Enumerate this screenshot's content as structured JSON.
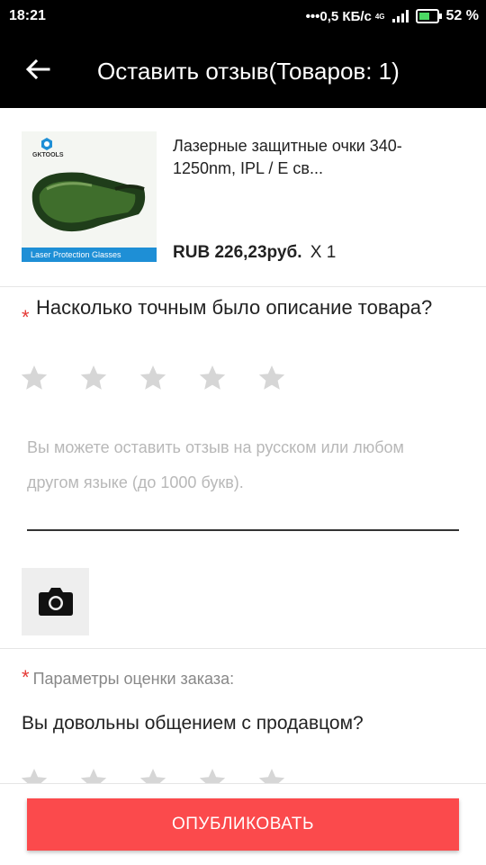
{
  "status_bar": {
    "time": "18:21",
    "network_speed": "0,5 КБ/с",
    "network_type": "4G",
    "battery": "52 %"
  },
  "header": {
    "title": "Оставить отзыв(Товаров: 1)"
  },
  "product": {
    "name": "Лазерные защитные очки 340-1250nm, IPL / E св...",
    "image_brand": "GKTOOLS",
    "image_caption": "Laser Protection Glasses",
    "price": "RUB 226,23руб.",
    "quantity": "X 1"
  },
  "question1": {
    "required_mark": "*",
    "text": "Насколько точным было описание товара?",
    "rating": 0
  },
  "review": {
    "placeholder": "Вы можете оставить отзыв на русском или любом другом языке (до 1000 букв)."
  },
  "params": {
    "required_mark": "*",
    "label": "Параметры оценки заказа:"
  },
  "question2": {
    "text": "Вы довольны общением с продавцом?",
    "rating": 0
  },
  "publish_button": {
    "label": "ОПУБЛИКОВАТЬ"
  },
  "colors": {
    "accent": "#fb4a4c",
    "required": "#e53935",
    "star_empty": "#d6d6d6"
  }
}
